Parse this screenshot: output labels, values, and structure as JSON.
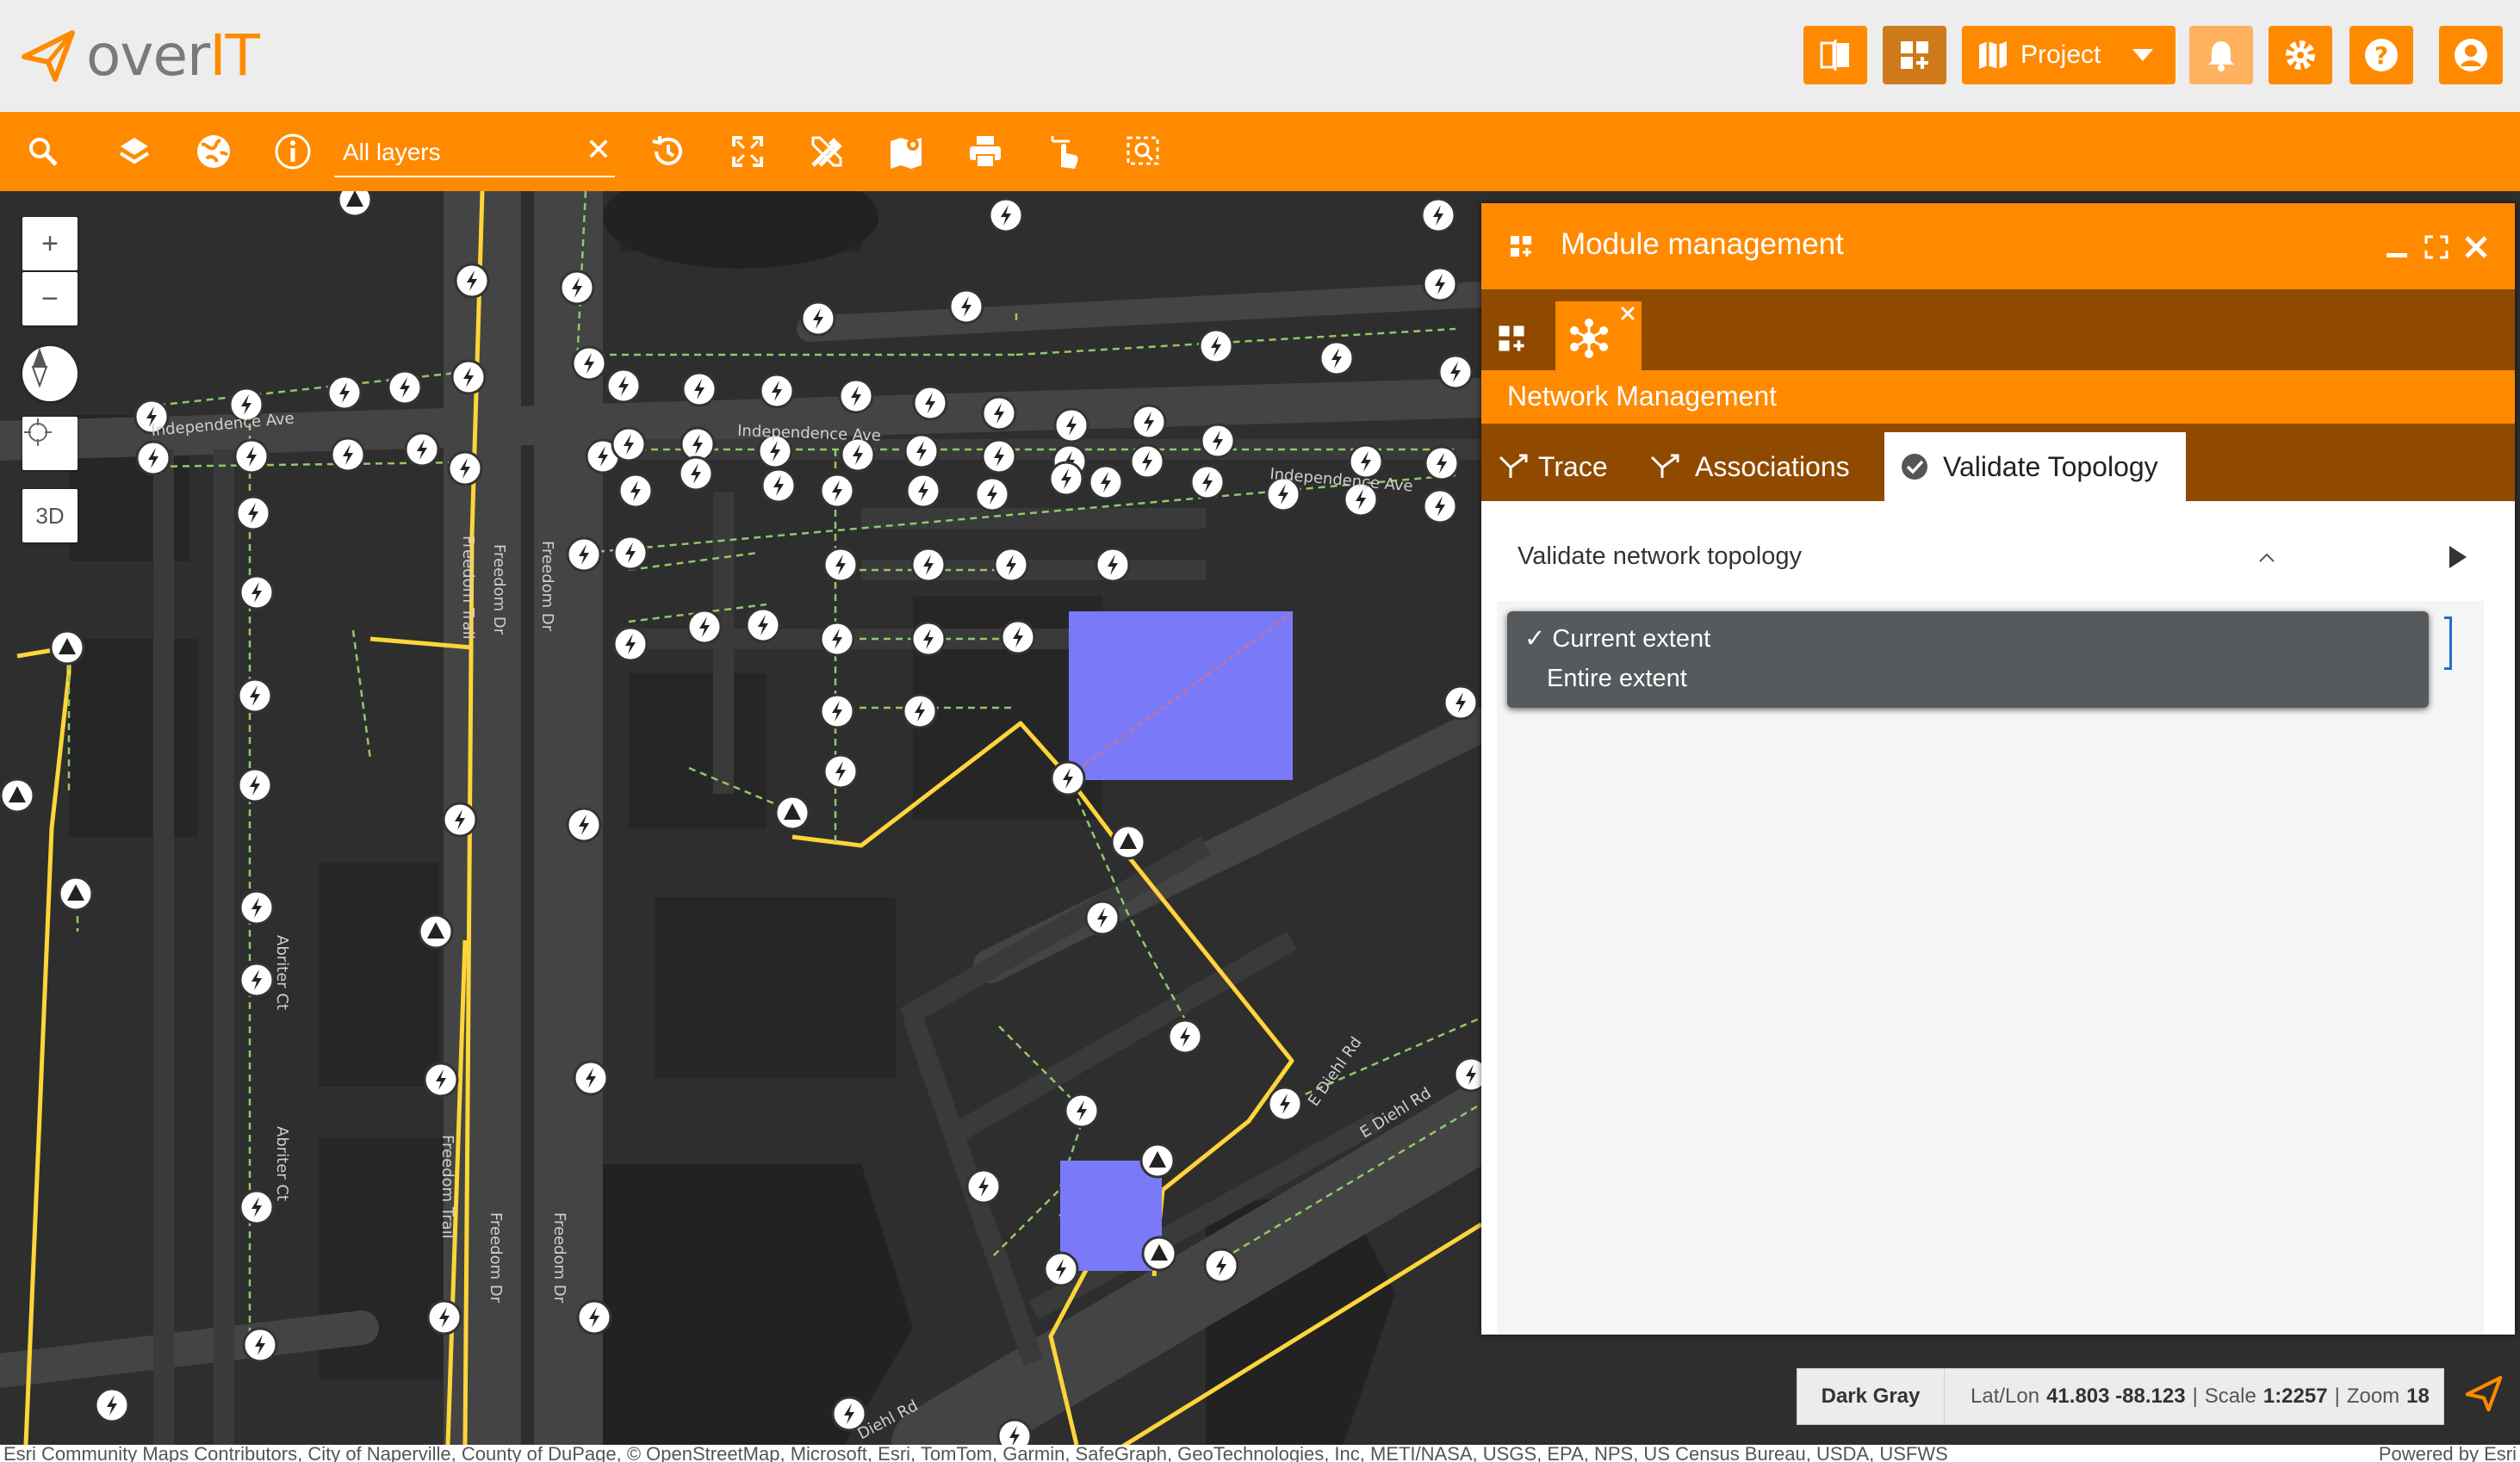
{
  "app": {
    "logo_text_main": "over",
    "logo_text_accent": "IT"
  },
  "header": {
    "project_label": "Project",
    "buttons": [
      "compare-icon",
      "add-widget-icon",
      "map-icon",
      "bell-icon",
      "gear-icon",
      "help-icon",
      "user-icon"
    ]
  },
  "toolbar": {
    "layer_select_value": "All layers",
    "clear_symbol": "✕",
    "tools": [
      "search-icon",
      "layers-icon",
      "globe-icon",
      "info-icon",
      "history-icon",
      "fullscreen-icon",
      "tools-icon",
      "map-pins-icon",
      "print-icon",
      "touch-icon",
      "select-area-icon"
    ]
  },
  "map": {
    "zoom_in": "+",
    "zoom_out": "−",
    "view_3d": "3D",
    "street_labels": [
      "Independence Ave",
      "Independence Ave",
      "Independence Ave",
      "Freedom Dr",
      "Freedom Dr",
      "Freedom Dr",
      "Freedom Dr",
      "Freedom Trail",
      "Freedom Trail",
      "Abriter Ct",
      "Abriter Ct",
      "E Diehl Rd",
      "E Diehl Rd",
      "Diehl Rd"
    ]
  },
  "panel": {
    "title": "Module management",
    "module_name": "Network Management",
    "tabs": [
      {
        "label": "Trace",
        "icon": "trace-icon"
      },
      {
        "label": "Associations",
        "icon": "associations-icon"
      },
      {
        "label": "Validate Topology",
        "icon": "check-circle-icon",
        "active": true
      }
    ],
    "section_title": "Validate network topology",
    "dropdown_options": [
      {
        "label": "Current extent",
        "selected": true,
        "check": "✓"
      },
      {
        "label": "Entire extent",
        "selected": false
      }
    ]
  },
  "status": {
    "basemap": "Dark Gray",
    "latlon_label": "Lat/Lon",
    "latlon_value": "41.803 -88.123",
    "scale_label": "Scale",
    "scale_value": "1:2257",
    "zoom_label": "Zoom",
    "zoom_value": "18"
  },
  "attribution": "Esri Community Maps Contributors, City of Naperville, County of DuPage, © OpenStreetMap, Microsoft, Esri, TomTom, Garmin, SafeGraph, GeoTechnologies, Inc, METI/NASA, USGS, EPA, NPS, US Census Bureau, USDA, USFWS",
  "powered_by": "Powered by Esri"
}
